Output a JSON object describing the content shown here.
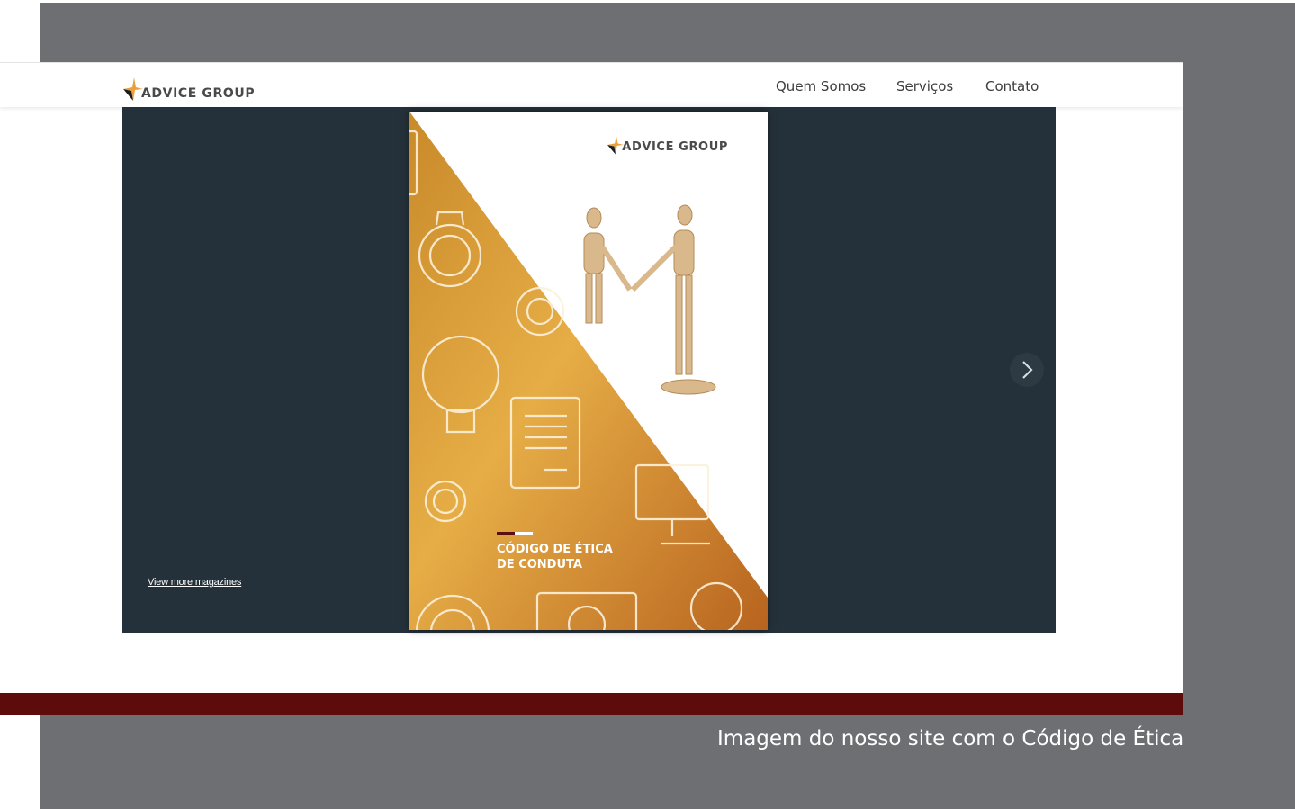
{
  "site": {
    "brand": "ADVICE GROUP",
    "nav": [
      "Quem Somos",
      "Serviços",
      "Contato"
    ]
  },
  "viewer": {
    "view_more_link": "View more magazines",
    "cover": {
      "brand": "ADVICE GROUP",
      "title_line1": "CÓDIGO DE ÉTICA",
      "title_line2": "DE CONDUTA"
    }
  },
  "slide": {
    "caption": "Imagem do nosso site com o Código de Ética"
  },
  "colors": {
    "slide_background": "#6e6f73",
    "viewer_background": "#25313a",
    "band": "#5e0b0b",
    "cover_gold": "#e1a23a",
    "brand_accent": "#e8a23c"
  }
}
